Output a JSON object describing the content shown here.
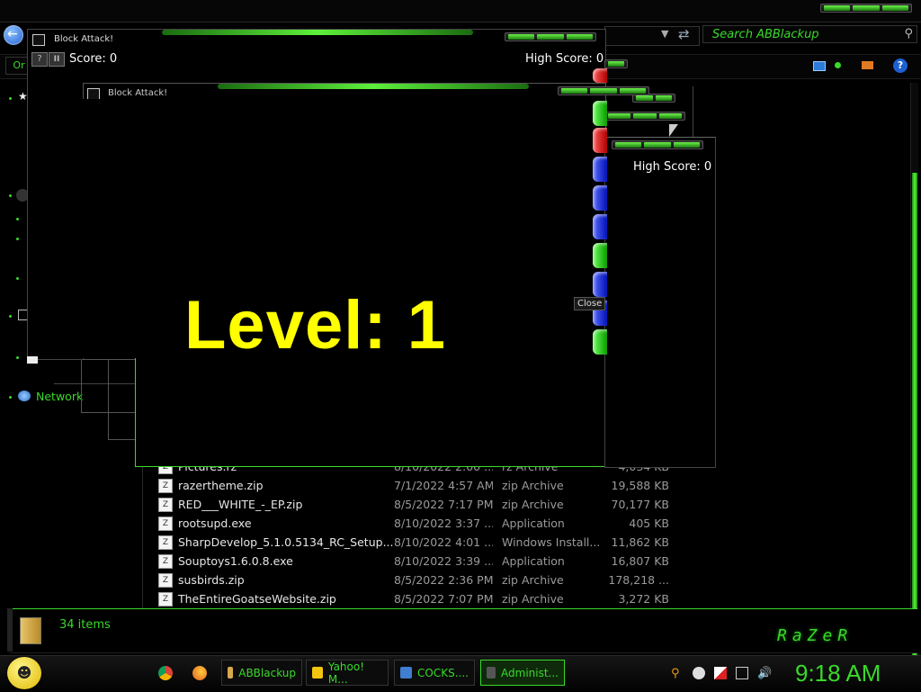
{
  "explorer": {
    "search_placeholder": "Search ABBlackup",
    "toolbar_label": "Or",
    "nav_item_network": "Network",
    "status_count": "34 items",
    "brand": "RaZeR",
    "files": [
      {
        "name": "Pictures.rz",
        "date": "8/10/2022 2:00 ...",
        "type": "rz Archive",
        "size": "4,034 KB",
        "icon": "archive-icon"
      },
      {
        "name": "razertheme.zip",
        "date": "7/1/2022 4:57 AM",
        "type": "zip Archive",
        "size": "19,588 KB",
        "icon": "zip-icon"
      },
      {
        "name": "RED___WHITE_-_EP.zip",
        "date": "8/5/2022 7:17 PM",
        "type": "zip Archive",
        "size": "70,177 KB",
        "icon": "zip-icon"
      },
      {
        "name": "rootsupd.exe",
        "date": "8/10/2022 3:37 ...",
        "type": "Application",
        "size": "405 KB",
        "icon": "exe-icon"
      },
      {
        "name": "SharpDevelop_5.1.0.5134_RC_Setup...",
        "date": "8/10/2022 4:01 ...",
        "type": "Windows Install...",
        "size": "11,862 KB",
        "icon": "installer-icon"
      },
      {
        "name": "Souptoys1.6.0.8.exe",
        "date": "8/10/2022 3:39 ...",
        "type": "Application",
        "size": "16,807 KB",
        "icon": "souptoys-icon"
      },
      {
        "name": "susbirds.zip",
        "date": "8/5/2022 2:36 PM",
        "type": "zip Archive",
        "size": "178,218 ...",
        "icon": "zip-icon"
      },
      {
        "name": "TheEntireGoatseWebsite.zip",
        "date": "8/5/2022 7:07 PM",
        "type": "zip Archive",
        "size": "3,272 KB",
        "icon": "zip-icon"
      }
    ]
  },
  "game_back": {
    "title": "Block Attack!",
    "score": "Score: 0",
    "high_score": "High Score: 0",
    "help_label": "?",
    "pause_label": "II"
  },
  "game_front": {
    "title": "Block Attack!",
    "level_text": "Level: 1",
    "high_score": "High Score: 0",
    "close_tooltip": "Close"
  },
  "taskbar": {
    "buttons": [
      {
        "label": "ABBlackup",
        "icon": "folder-icon"
      },
      {
        "label": "Yahoo! M...",
        "icon": "yahoo-messenger-icon"
      },
      {
        "label": "COCKS....",
        "icon": "window-icon"
      },
      {
        "label": "Administ...",
        "icon": "cmd-icon"
      }
    ],
    "clock": "9:18 AM"
  },
  "colors": {
    "accent": "#39d92a",
    "level_text": "#ffff00"
  }
}
